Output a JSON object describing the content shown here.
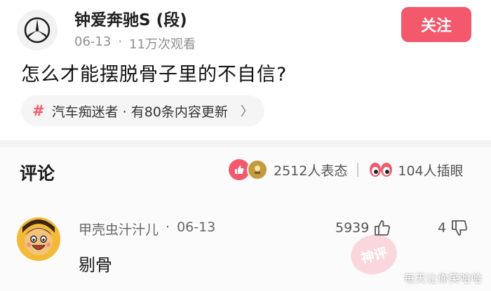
{
  "post": {
    "author": "钟爱奔驰S (段)",
    "date": "06-13",
    "views": "11万次观看",
    "follow_label": "关注",
    "question": "怎么才能摆脱骨子里的不自信?",
    "topic": {
      "hash": "#",
      "text": "汽车痴迷者 · 有80条内容更新",
      "chevron": "〉"
    }
  },
  "comments_section": {
    "title": "评论",
    "reactions_count": "2512人表态",
    "eyes_count": "104人插眼"
  },
  "comment": {
    "user": "甲壳虫汁汁儿",
    "date": "06-13",
    "likes": "5939",
    "dislikes": "4",
    "text": "剔骨"
  },
  "overlay": {
    "stamp_text": "神评",
    "watermark": "每天让你笑哈哈"
  },
  "colors": {
    "accent": "#f4586c",
    "text_muted": "#8f8f8f"
  },
  "icons": [
    "mercedes-logo-icon",
    "hash-icon",
    "chevron-right-icon",
    "like-reaction-icon",
    "trophy-reaction-icon",
    "eyes-icon",
    "thumbs-up-icon",
    "thumbs-down-icon"
  ]
}
